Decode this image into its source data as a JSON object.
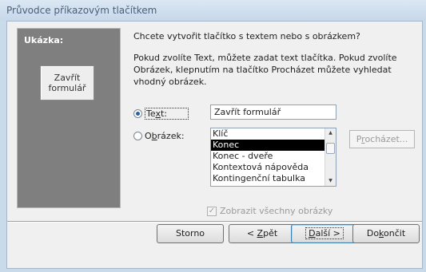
{
  "window": {
    "title": "Průvodce příkazovým tlačítkem"
  },
  "sample": {
    "label": "Ukázka:",
    "button_line1": "Zavřít",
    "button_line2": "formulář"
  },
  "prompt": {
    "question": "Chcete vytvořit tlačítko s textem nebo s obrázkem?",
    "description": "Pokud zvolíte Text, můžete zadat text tlačítka. Pokud zvolíte Obrázek, klepnutím na tlačítko Procházet můžete vyhledat vhodný obrázek."
  },
  "options": {
    "text_radio": {
      "pre": "Te",
      "accel": "x",
      "post": "t:",
      "checked": true
    },
    "image_radio": {
      "pre": "O",
      "accel": "b",
      "post": "rázek:",
      "checked": false
    },
    "text_value": "Zavřít formulář",
    "image_list": {
      "items": [
        "Klíč",
        "Konec",
        "Konec - dveře",
        "Kontextová nápověda",
        "Kontingenční tabulka"
      ],
      "selected_index": 1
    },
    "browse_button": {
      "pre": "P",
      "accel": "r",
      "post": "ocházet..."
    },
    "show_all_images": {
      "label": "Zobrazit všechny obrázky",
      "checked": true,
      "enabled": false
    }
  },
  "buttons": {
    "cancel": "Storno",
    "back": {
      "pre": "< ",
      "accel": "Z",
      "post": "pět"
    },
    "next": {
      "pre": "",
      "accel": "D",
      "post": "alší >"
    },
    "finish": {
      "pre": "Do",
      "accel": "k",
      "post": "ončit"
    }
  },
  "colors": {
    "frame": "#c9daea",
    "title_text": "#4a5f78",
    "sample_panel": "#7f7f7f",
    "selected_item": "#000000"
  }
}
